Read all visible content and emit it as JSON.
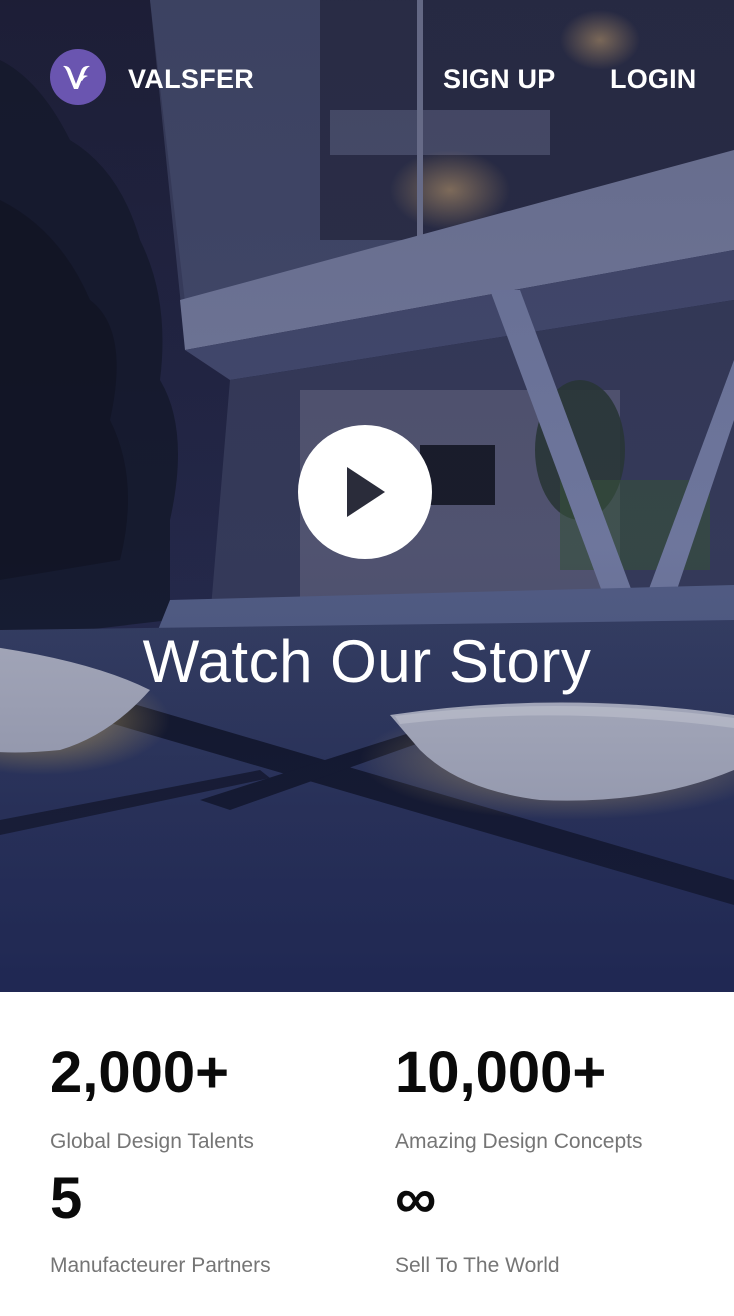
{
  "header": {
    "brand_name": "VALSFER",
    "logo_icon": "valsfer-logo-icon",
    "nav": {
      "signup_label": "SIGN UP",
      "login_label": "LOGIN"
    }
  },
  "hero": {
    "title": "Watch Our Story",
    "play_icon": "play-icon"
  },
  "stats": [
    {
      "value": "2,000+",
      "label": "Global Design Talents"
    },
    {
      "value": "10,000+",
      "label": "Amazing Design Concepts"
    },
    {
      "value": "5",
      "label": "Manufacteurer Partners"
    },
    {
      "value": "∞",
      "label": "Sell To The World"
    }
  ],
  "colors": {
    "brand_accent": "#6a55b0",
    "hero_tint": "#242a4a",
    "stat_value": "#0a0a0a",
    "stat_label": "#757575"
  }
}
